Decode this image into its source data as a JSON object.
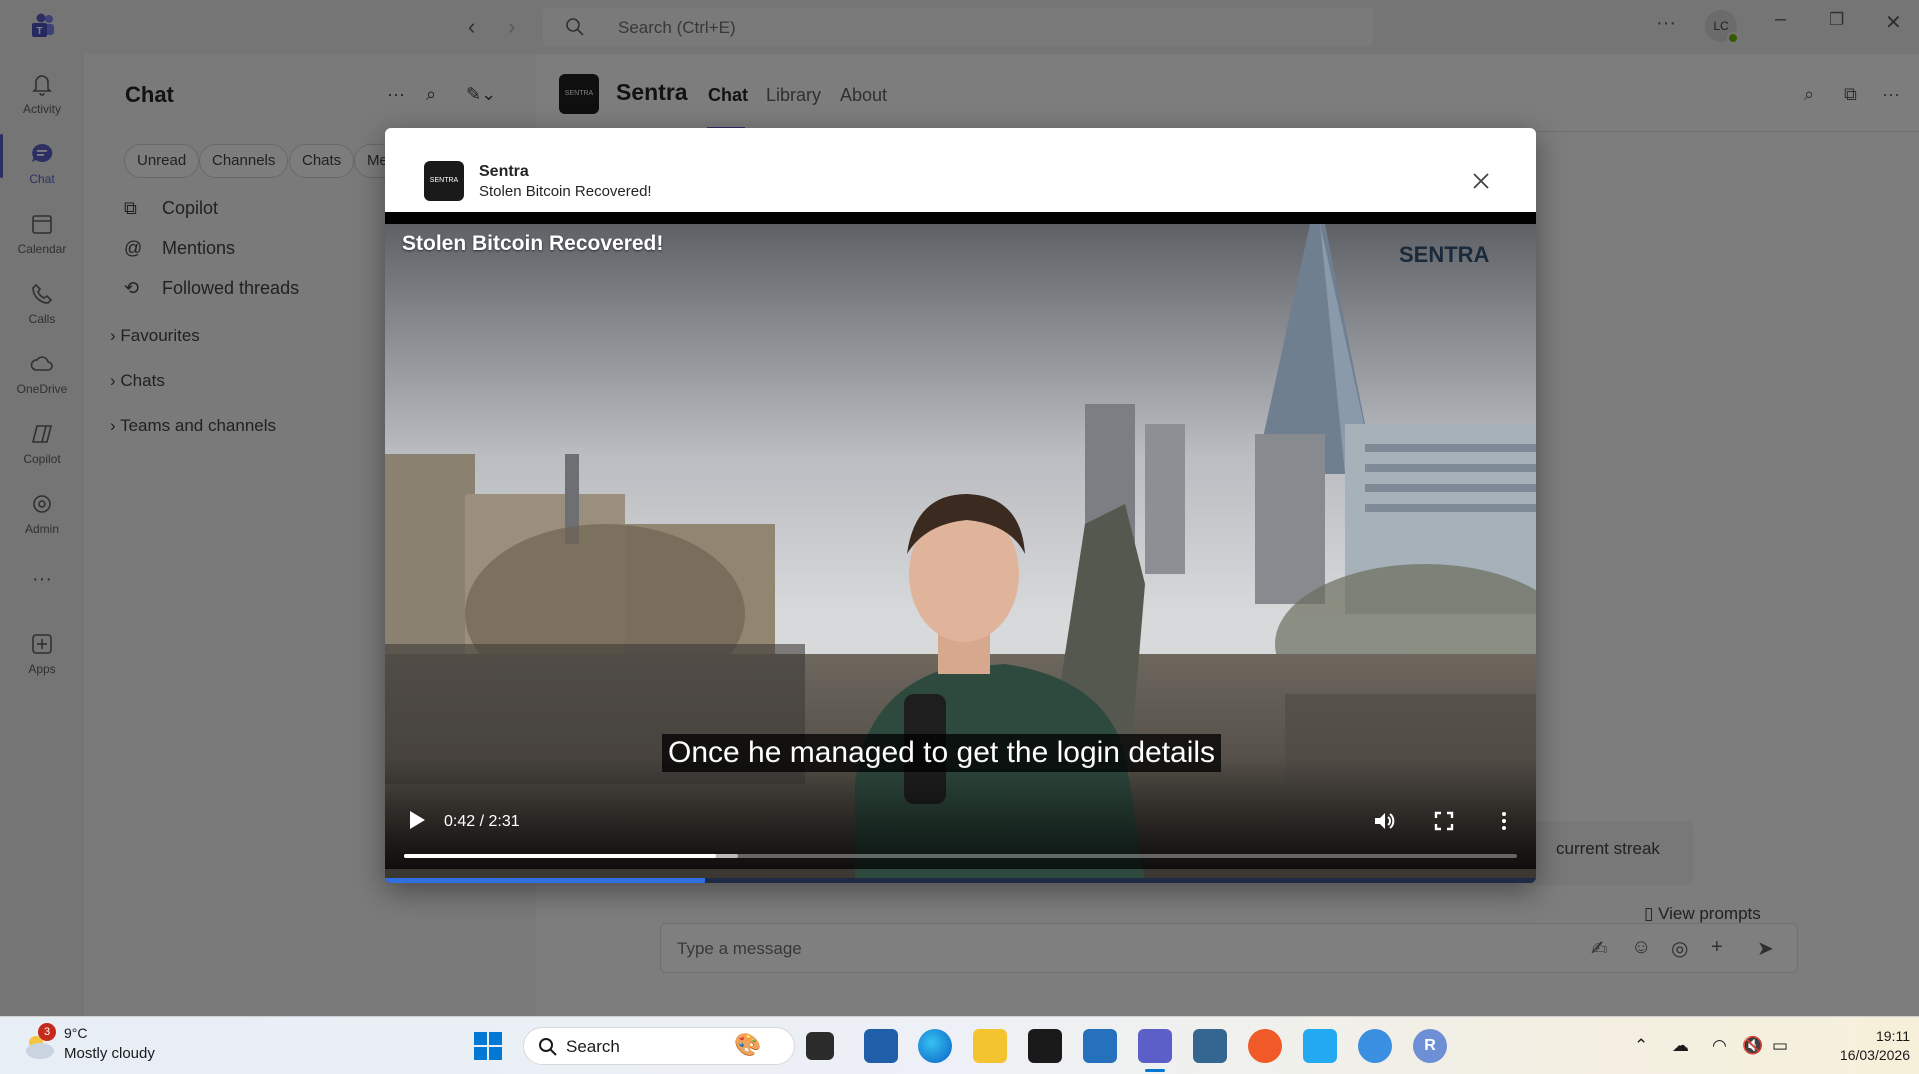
{
  "titlebar": {
    "search_placeholder": "Search (Ctrl+E)",
    "avatar_initials": "LC"
  },
  "rail": {
    "items": [
      {
        "label": "Activity"
      },
      {
        "label": "Chat"
      },
      {
        "label": "Calendar"
      },
      {
        "label": "Calls"
      },
      {
        "label": "OneDrive"
      },
      {
        "label": "Copilot"
      },
      {
        "label": "Admin"
      },
      {
        "label": "Apps"
      }
    ]
  },
  "chatpanel": {
    "title": "Chat",
    "filters": [
      "Unread",
      "Channels",
      "Chats",
      "Me"
    ],
    "rows": [
      "Copilot",
      "Mentions",
      "Followed threads"
    ],
    "groups": [
      "Favourites",
      "Chats",
      "Teams and channels"
    ]
  },
  "main": {
    "title": "Sentra",
    "tabs": [
      "Chat",
      "Library",
      "About"
    ],
    "streak_text": "current streak",
    "view_prompts": "View prompts",
    "composer_placeholder": "Type a message"
  },
  "modal": {
    "app_name": "Sentra",
    "subtitle": "Stolen Bitcoin Recovered!",
    "video": {
      "title": "Stolen Bitcoin Recovered!",
      "brand": "SENTRA",
      "caption": "Once he managed to get the login details",
      "time": "0:42 / 2:31",
      "progress": 0.28,
      "buffered": 0.3,
      "bottom_progress": 0.278
    }
  },
  "taskbar": {
    "weather_badge": "3",
    "temperature": "9°C",
    "condition": "Mostly cloudy",
    "search_placeholder": "Search",
    "time": "19:11",
    "date": "16/03/2026"
  },
  "colors": {
    "accent": "#5b5fc7",
    "video_progress": "#2f6fe0"
  }
}
